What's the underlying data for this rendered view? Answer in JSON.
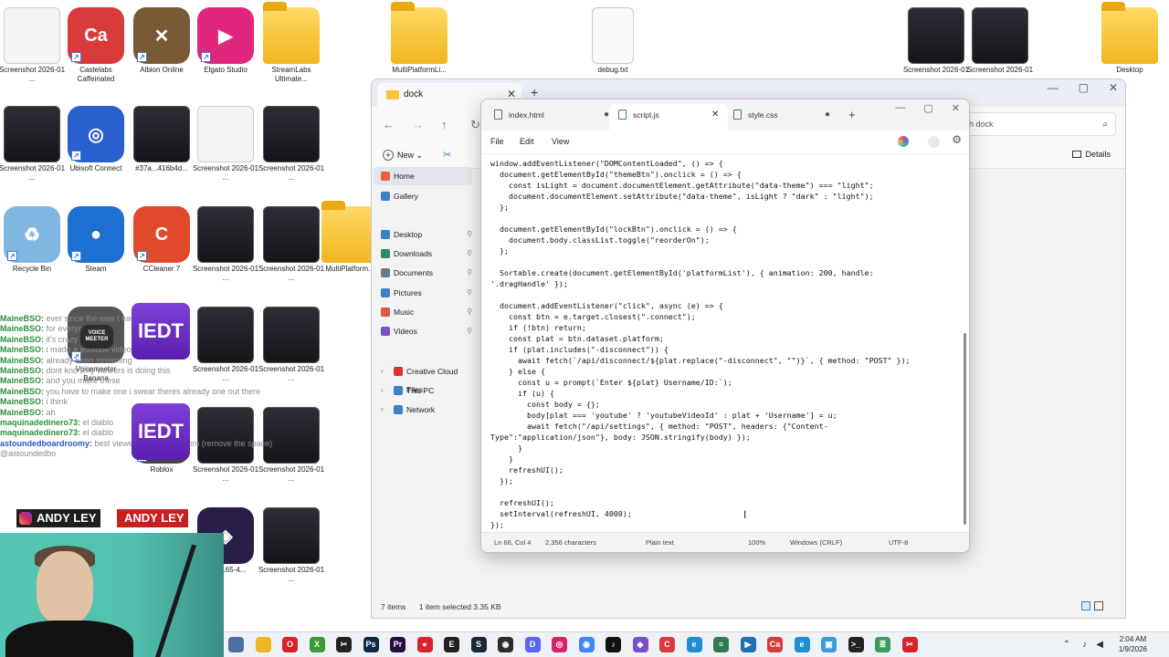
{
  "desktop": {
    "icons": [
      {
        "label": "Screenshot 2026-01 ...",
        "kind": "light"
      },
      {
        "label": "Castelabs Caffeinated",
        "kind": "app",
        "text": "Ca",
        "color": "#d93a3a"
      },
      {
        "label": "Albion Online",
        "kind": "app",
        "text": "✕",
        "color": "#7a5a36"
      },
      {
        "label": "Elgato Studio",
        "kind": "app",
        "text": "▶",
        "color": "#e0267d"
      },
      {
        "label": "StreamLabs Ultimate...",
        "kind": "folder"
      },
      {
        "label": "MultiPlatformLi...",
        "kind": "folder"
      },
      {
        "label": "debug.txt",
        "kind": "doc"
      },
      {
        "label": "Screenshot 2026-01 ...",
        "kind": "shot"
      },
      {
        "label": "Screenshot 2026-01 ...",
        "kind": "shot"
      },
      {
        "label": "Desktop",
        "kind": "folder"
      },
      {
        "label": "Screenshot 2026-01 ...",
        "kind": "shot"
      },
      {
        "label": "Ubisoft Connect",
        "kind": "app",
        "text": "◎",
        "color": "#2a5fd0"
      },
      {
        "label": "#37a...416b4d...",
        "kind": "shot"
      },
      {
        "label": "Screenshot 2026-01 ...",
        "kind": "light"
      },
      {
        "label": "Screenshot 2026-01 ...",
        "kind": "shot"
      },
      {
        "label": "Recycle Bin",
        "kind": "app",
        "text": "♻",
        "color": "#7fb7e0"
      },
      {
        "label": "Steam",
        "kind": "app",
        "text": "●",
        "color": "#1d6fd1"
      },
      {
        "label": "CCleaner 7",
        "kind": "app",
        "text": "C",
        "color": "#e04a2a"
      },
      {
        "label": "Screenshot 2026-01 ...",
        "kind": "shot"
      },
      {
        "label": "Screenshot 2026-01 ...",
        "kind": "shot"
      },
      {
        "label": "MultiPlatform...",
        "kind": "folder"
      },
      {
        "label": "Voicemeeter Banana",
        "kind": "app",
        "text": "VM",
        "color": "#555555"
      },
      {
        "label": "Screenshot 2026-01 ...",
        "kind": "shot"
      },
      {
        "label": "Screenshot 2026-01 ...",
        "kind": "shot"
      },
      {
        "label": "Roblox",
        "kind": "app",
        "text": "■",
        "color": "#444444"
      },
      {
        "label": "Screenshot 2026-01 ...",
        "kind": "shot"
      },
      {
        "label": "Screenshot 2026-01 ...",
        "kind": "shot"
      },
      {
        "label": "eth 0165-4...",
        "kind": "app",
        "text": "◈",
        "color": "#2b1d4a"
      },
      {
        "label": "Screenshot 2026-01 ...",
        "kind": "shot"
      }
    ]
  },
  "overlay": {
    "chat": [
      {
        "user": "MaineBSO:",
        "msg": "ever since the wee I eat nigga lol"
      },
      {
        "user": "MaineBSO:",
        "msg": "for everyone"
      },
      {
        "user": "MaineBSO:",
        "msg": "it's crazy"
      },
      {
        "user": "MaineBSO:",
        "msg": "i made a youtube video"
      },
      {
        "user": "MaineBSO:",
        "msg": "already been streaming"
      },
      {
        "user": "MaineBSO:",
        "msg": "dont kno why viewers is doing this"
      },
      {
        "user": "MaineBSO:",
        "msg": "and you make these"
      },
      {
        "user": "MaineBSO:",
        "msg": "you have to make one i swear theres already one out there"
      },
      {
        "user": "MaineBSO:",
        "msg": "i think"
      },
      {
        "user": "MaineBSO:",
        "msg": "ah"
      },
      {
        "user": "maquinadedinero73:",
        "msg": "el diablo"
      },
      {
        "user": "maquinadedinero73:",
        "msg": "el diablo"
      },
      {
        "user": "astoundedboardroomy:",
        "msg": "best viewers streamboo.com (remove the space)"
      },
      {
        "user": "",
        "msg": "@astoundedbo"
      }
    ],
    "cards": [
      "IEDT",
      "IEDT"
    ],
    "name_tags": [
      "ANDY LEY",
      "ANDY LEY"
    ],
    "voicemeeter_label": "VOICE MEETER"
  },
  "explorer": {
    "tab_title": "dock",
    "search_placeholder": "h dock",
    "new_label": "New",
    "details_label": "Details",
    "sidebar": [
      {
        "label": "Home",
        "icon": "home-icon",
        "color": "#e8603a"
      },
      {
        "label": "Gallery",
        "icon": "gallery-icon",
        "color": "#3b82c4"
      },
      {
        "label": "Desktop",
        "icon": "desktop-icon",
        "color": "#3b82c4",
        "pinned": true
      },
      {
        "label": "Downloads",
        "icon": "download-icon",
        "color": "#2f8f5b",
        "pinned": true
      },
      {
        "label": "Documents",
        "icon": "documents-icon",
        "color": "#6a7a8a",
        "pinned": true
      },
      {
        "label": "Pictures",
        "icon": "pictures-icon",
        "color": "#3b82c4",
        "pinned": true
      },
      {
        "label": "Music",
        "icon": "music-icon",
        "color": "#e0554a",
        "pinned": true
      },
      {
        "label": "Videos",
        "icon": "videos-icon",
        "color": "#7b4fc9",
        "pinned": true
      },
      {
        "label": "Creative Cloud Files",
        "icon": "creative-cloud-icon",
        "color": "#d9342b"
      },
      {
        "label": "This PC",
        "icon": "pc-icon",
        "color": "#3b82c4"
      },
      {
        "label": "Network",
        "icon": "network-icon",
        "color": "#3b82c4"
      }
    ],
    "status": {
      "items": "7 items",
      "selected": "1 item selected  3.35 KB"
    }
  },
  "notepad": {
    "tabs": [
      {
        "label": "index.html",
        "active": false
      },
      {
        "label": "script.js",
        "active": true
      },
      {
        "label": "style.css",
        "active": false
      }
    ],
    "menu": [
      "File",
      "Edit",
      "View"
    ],
    "code": "window.addEventListener(\"DOMContentLoaded\", () => {\n  document.getElementById(\"themeBtn\").onclick = () => {\n    const isLight = document.documentElement.getAttribute(\"data-theme\") === \"light\";\n    document.documentElement.setAttribute(\"data-theme\", isLight ? \"dark\" : \"light\");\n  };\n\n  document.getElementById(\"lockBtn\").onclick = () => {\n    document.body.classList.toggle(\"reorderOn\");\n  };\n\n  Sortable.create(document.getElementById('platformList'), { animation: 200, handle:\n'.dragHandle' });\n\n  document.addEventListener(\"click\", async (e) => {\n    const btn = e.target.closest(\".connect\");\n    if (!btn) return;\n    const plat = btn.dataset.platform;\n    if (plat.includes(\"-disconnect\")) {\n      await fetch(`/api/disconnect/${plat.replace(\"-disconnect\", \"\")}`, { method: \"POST\" });\n    } else {\n      const u = prompt(`Enter ${plat} Username/ID:`);\n      if (u) {\n        const body = {};\n        body[plat === 'youtube' ? 'youtubeVideoId' : plat + 'Username'] = u;\n        await fetch(\"/api/settings\", { method: \"POST\", headers: {\"Content-\nType\":\"application/json\"}, body: JSON.stringify(body) });\n      }\n    }\n    refreshUI();\n  });\n\n  refreshUI();\n  setInterval(refreshUI, 4000);\n});",
    "status": {
      "position": "Ln 66, Col 4",
      "chars": "2,356 characters",
      "format": "Plain text",
      "zoom": "100%",
      "line_endings": "Windows (CRLF)",
      "encoding": "UTF-8"
    }
  },
  "taskbar": {
    "apps": [
      {
        "name": "task-view-icon",
        "color": "#4a6fa5",
        "text": ""
      },
      {
        "name": "file-explorer-icon",
        "color": "#f1b61f",
        "text": ""
      },
      {
        "name": "opera-icon",
        "color": "#d8232a",
        "text": "O"
      },
      {
        "name": "xbox-icon",
        "color": "#3a9a3a",
        "text": "X"
      },
      {
        "name": "capcut-icon",
        "color": "#222222",
        "text": "✂"
      },
      {
        "name": "photoshop-icon",
        "color": "#0b2a4a",
        "text": "Ps"
      },
      {
        "name": "premiere-icon",
        "color": "#2a0b4a",
        "text": "Pr"
      },
      {
        "name": "record-icon",
        "color": "#d8232a",
        "text": "●"
      },
      {
        "name": "epic-games-icon",
        "color": "#222222",
        "text": "E"
      },
      {
        "name": "steam-icon",
        "color": "#1b2838",
        "text": "S"
      },
      {
        "name": "obs-icon",
        "color": "#2b2b2b",
        "text": "◉"
      },
      {
        "name": "discord-icon",
        "color": "#5865f2",
        "text": "D"
      },
      {
        "name": "instagram-icon",
        "color": "#d4246c",
        "text": "◎"
      },
      {
        "name": "chrome-icon",
        "color": "#4285f4",
        "text": "◉"
      },
      {
        "name": "tiktok-icon",
        "color": "#111111",
        "text": "♪"
      },
      {
        "name": "app-icon",
        "color": "#7a4fc9",
        "text": "◆"
      },
      {
        "name": "castelabs-icon",
        "color": "#d93a3a",
        "text": "C"
      },
      {
        "name": "edge-icon",
        "color": "#1d8fd1",
        "text": "e"
      },
      {
        "name": "notepad-icon",
        "color": "#2f7d4f",
        "text": "≡"
      },
      {
        "name": "media-icon",
        "color": "#1f6fb5",
        "text": "▶"
      },
      {
        "name": "caffeinated-icon",
        "color": "#d93a3a",
        "text": "Ca"
      },
      {
        "name": "edge-alt-icon",
        "color": "#1d8fd1",
        "text": "e"
      },
      {
        "name": "photos-icon",
        "color": "#3b9ad9",
        "text": "▣"
      },
      {
        "name": "terminal-icon",
        "color": "#222222",
        "text": ">_"
      },
      {
        "name": "notes-icon",
        "color": "#3a9a5a",
        "text": "≣"
      },
      {
        "name": "snipping-icon",
        "color": "#d8232a",
        "text": "✂"
      }
    ],
    "time": "2:04 AM",
    "date": "1/9/2026"
  }
}
